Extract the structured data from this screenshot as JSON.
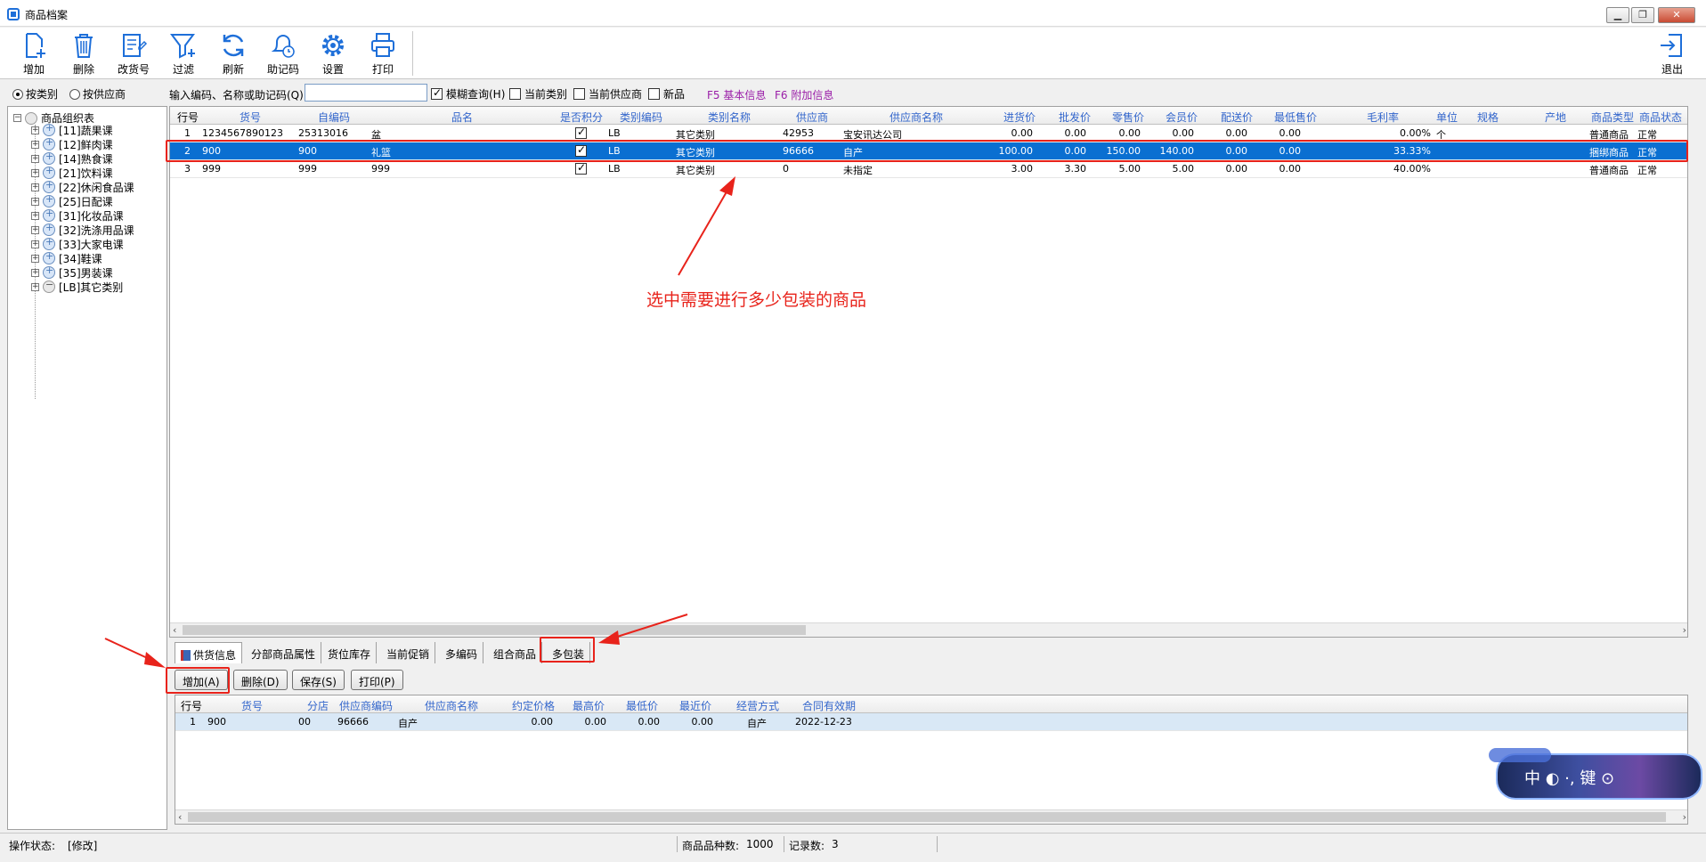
{
  "window": {
    "title": "商品档案",
    "controls": [
      "▁",
      "❐",
      "✕"
    ]
  },
  "toolbar": {
    "add": "增加",
    "delete": "删除",
    "change_code": "改货号",
    "filter": "过滤",
    "refresh": "刷新",
    "mnemonic": "助记码",
    "settings": "设置",
    "print": "打印",
    "exit": "退出"
  },
  "filterbar": {
    "by_category": "按类别",
    "by_supplier": "按供应商",
    "search_label": "输入编码、名称或助记码(Q)",
    "search_value": "",
    "fuzzy": "模糊查询(H)",
    "current_category": "当前类别",
    "current_supplier": "当前供应商",
    "new_item": "新品",
    "f5": "F5 基本信息",
    "f6": "F6 附加信息"
  },
  "tree": {
    "root": "商品组织表",
    "items": [
      "[11]蔬果课",
      "[12]鲜肉课",
      "[14]熟食课",
      "[21]饮料课",
      "[22]休闲食品课",
      "[25]日配课",
      "[31]化妆品课",
      "[32]洗涤用品课",
      "[33]大家电课",
      "[34]鞋课",
      "[35]男装课",
      "[LB]其它类别"
    ]
  },
  "grid": {
    "headers": [
      "行号",
      "货号",
      "自编码",
      "品名",
      "是否积分",
      "类别编码",
      "类别名称",
      "供应商",
      "供应商名称",
      "进货价",
      "批发价",
      "零售价",
      "会员价",
      "配送价",
      "最低售价",
      "毛利率",
      "单位",
      "规格",
      "产地",
      "商品类型",
      "商品状态"
    ],
    "rows": [
      {
        "no": "1",
        "code": "1234567890123",
        "self": "25313016",
        "name": "盆",
        "cat_code": "LB",
        "cat_name": "其它类别",
        "sup": "42953",
        "sup_name": "宝安讯达公司",
        "buy": "0.00",
        "wholesale": "0.00",
        "retail": "0.00",
        "member": "0.00",
        "delivery": "0.00",
        "min": "0.00",
        "margin": "0.00%",
        "unit": "个",
        "type": "普通商品",
        "status": "正常"
      },
      {
        "no": "2",
        "code": "900",
        "self": "900",
        "name": "礼篮",
        "cat_code": "LB",
        "cat_name": "其它类别",
        "sup": "96666",
        "sup_name": "自产",
        "buy": "100.00",
        "wholesale": "0.00",
        "retail": "150.00",
        "member": "140.00",
        "delivery": "0.00",
        "min": "0.00",
        "margin": "33.33%",
        "unit": "",
        "type": "捆绑商品",
        "status": "正常"
      },
      {
        "no": "3",
        "code": "999",
        "self": "999",
        "name": "999",
        "cat_code": "LB",
        "cat_name": "其它类别",
        "sup": "0",
        "sup_name": "未指定",
        "buy": "3.00",
        "wholesale": "3.30",
        "retail": "5.00",
        "member": "5.00",
        "delivery": "0.00",
        "min": "0.00",
        "margin": "40.00%",
        "unit": "",
        "type": "普通商品",
        "status": "正常"
      }
    ]
  },
  "annotation": "选中需要进行多少包装的商品",
  "tabs": [
    "供货信息",
    "分部商品属性",
    "货位库存",
    "当前促销",
    "多编码",
    "组合商品",
    "多包装"
  ],
  "sub_buttons": {
    "add": "增加(A)",
    "delete": "删除(D)",
    "save": "保存(S)",
    "print": "打印(P)"
  },
  "subgrid": {
    "headers": [
      "行号",
      "货号",
      "分店",
      "供应商编码",
      "供应商名称",
      "约定价格",
      "最高价",
      "最低价",
      "最近价",
      "经营方式",
      "合同有效期"
    ],
    "rows": [
      {
        "no": "1",
        "code": "900",
        "branch": "00",
        "sup_code": "96666",
        "sup_name": "自产",
        "price": "0.00",
        "max": "0.00",
        "min": "0.00",
        "last": "0.00",
        "mode": "自产",
        "expiry": "2022-12-23"
      }
    ]
  },
  "mascot": "中 ◐ ·, 键 ⊙",
  "status": {
    "state_label": "操作状态:",
    "state_value": "[修改]",
    "count_label": "商品品种数:",
    "count_value": "1000",
    "records_label": "记录数:",
    "records_value": "3"
  },
  "colors": {
    "selection": "#0a6fd1",
    "annotation": "#e8231b",
    "header_text": "#3366cc"
  }
}
